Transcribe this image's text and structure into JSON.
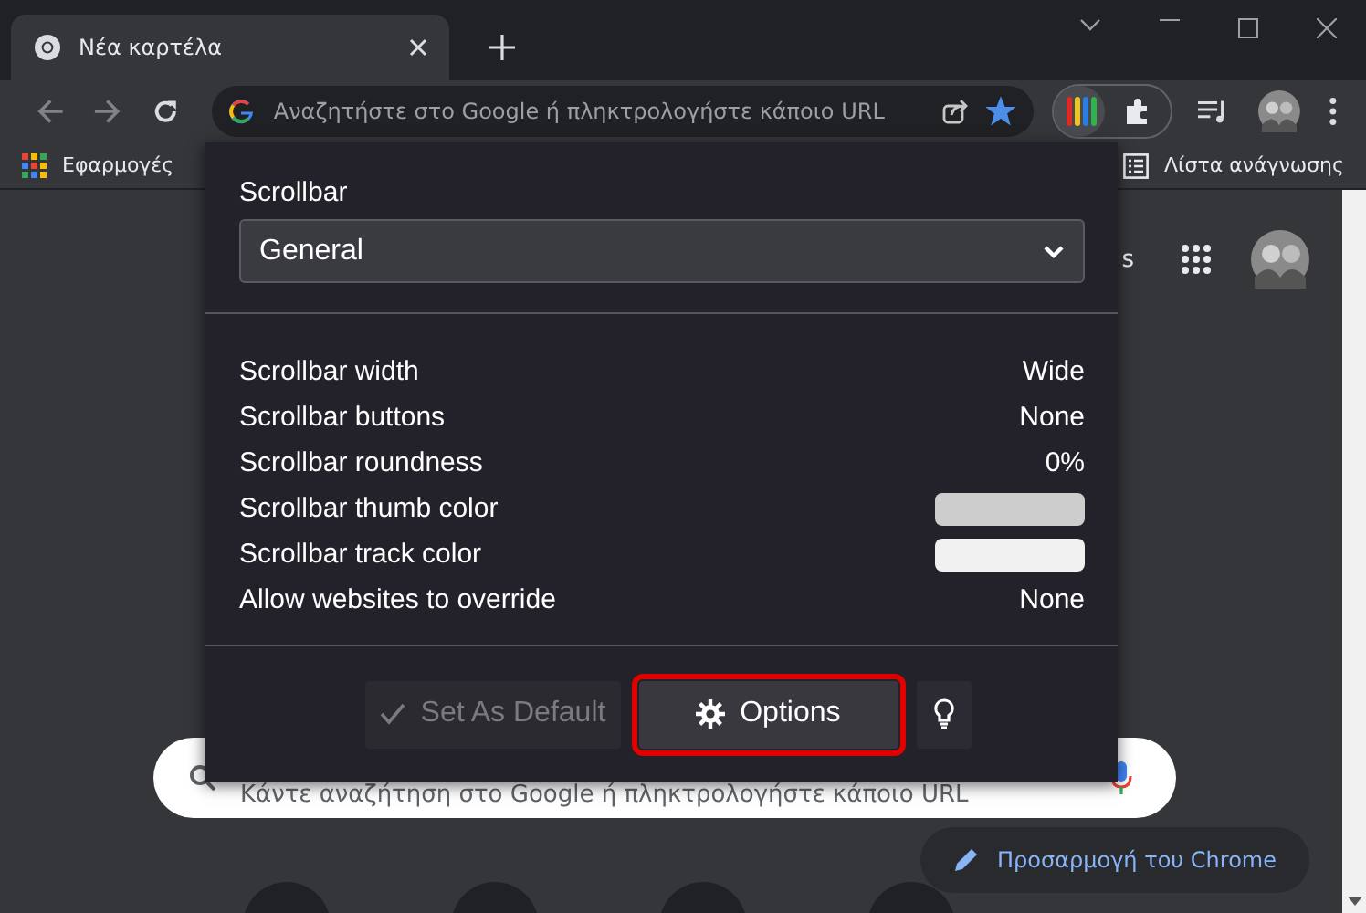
{
  "window": {
    "tabs": [
      {
        "title": "Νέα καρτέλα",
        "selected": true
      }
    ]
  },
  "toolbar": {
    "omnibox": {
      "placeholder": "Αναζητήστε στο Google ή πληκτρολογήστε κάποιο URL"
    },
    "bookmarked": true
  },
  "bookmarks_bar": {
    "left": [
      {
        "label": "Εφαρμογές"
      }
    ],
    "right": [
      {
        "label": "Λίστα ανάγνωσης"
      }
    ]
  },
  "new_tab_page": {
    "header_fragment": "s",
    "search": {
      "placeholder": "Κάντε αναζήτηση στο Google ή πληκτρολογήστε κάποιο URL"
    },
    "customize_button": "Προσαρμογή του Chrome"
  },
  "popup": {
    "section_label": "Scrollbar",
    "dropdown": {
      "value": "General"
    },
    "settings": [
      {
        "label": "Scrollbar width",
        "kind": "text",
        "value": "Wide"
      },
      {
        "label": "Scrollbar buttons",
        "kind": "text",
        "value": "None"
      },
      {
        "label": "Scrollbar roundness",
        "kind": "text",
        "value": "0%"
      },
      {
        "label": "Scrollbar thumb color",
        "kind": "swatch",
        "color": "#cdcdcd"
      },
      {
        "label": "Scrollbar track color",
        "kind": "swatch",
        "color": "#f1f1f1"
      },
      {
        "label": "Allow websites to override",
        "kind": "text",
        "value": "None"
      }
    ],
    "buttons": [
      {
        "label": "Set As Default",
        "kind": "check",
        "disabled": true,
        "highlighted": false
      },
      {
        "label": "Options",
        "kind": "gear",
        "disabled": false,
        "highlighted": true
      },
      {
        "kind": "bulb",
        "disabled": false,
        "highlighted": false
      }
    ]
  }
}
